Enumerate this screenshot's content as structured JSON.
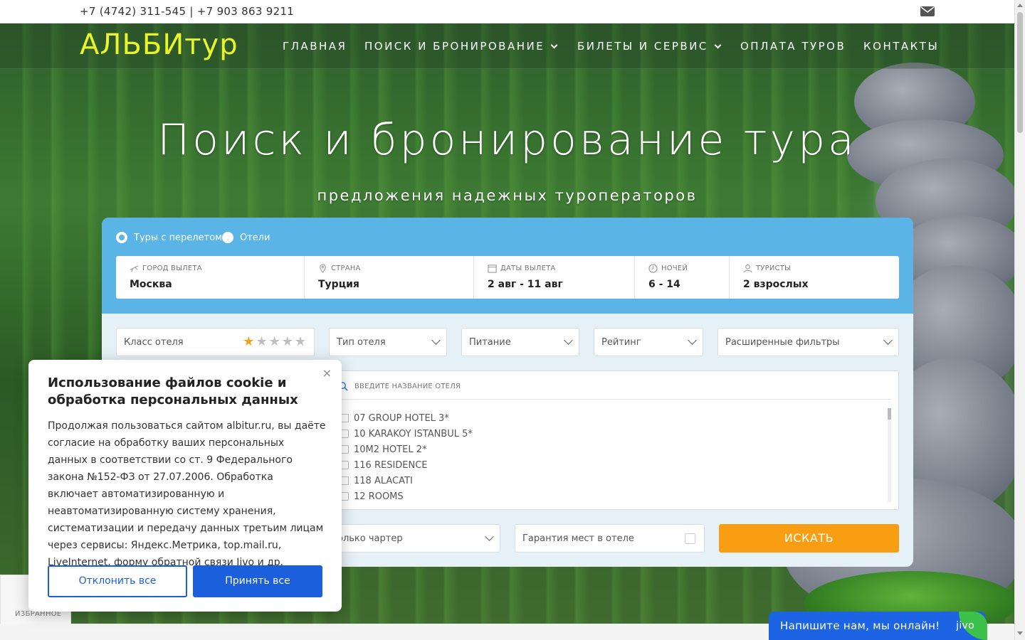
{
  "topbar": {
    "phones": "+7 (4742) 311-545 | +7 903 863 9211"
  },
  "nav": {
    "logo": "АЛЬБИтур",
    "items": [
      {
        "label": "ГЛАВНАЯ"
      },
      {
        "label": "ПОИСК И БРОНИРОВАНИЕ"
      },
      {
        "label": "БИЛЕТЫ И СЕРВИС"
      },
      {
        "label": "ОПЛАТА ТУРОВ"
      },
      {
        "label": "КОНТАКТЫ"
      }
    ]
  },
  "hero": {
    "title": "Поиск и бронирование тура",
    "subtitle": "предложения надежных туроператоров"
  },
  "search": {
    "modes": [
      {
        "label": "Туры с перелетом",
        "selected": true
      },
      {
        "label": "Отели",
        "selected": false
      }
    ],
    "fields": [
      {
        "label": "ГОРОД ВЫЛЕТА",
        "value": "Москва"
      },
      {
        "label": "СТРАНА",
        "value": "Турция"
      },
      {
        "label": "ДАТЫ ВЫЛЕТА",
        "value": "2 авг - 11 авг"
      },
      {
        "label": "НОЧЕЙ",
        "value": "6 - 14"
      },
      {
        "label": "ТУРИСТЫ",
        "value": "2 взрослых"
      }
    ],
    "filters": {
      "hotel_class": "Класс отеля",
      "hotel_class_stars": 1,
      "hotel_type": "Тип отеля",
      "meals": "Питание",
      "rating": "Рейтинг",
      "advanced": "Расширенные фильтры"
    },
    "hotel_search_placeholder": "ВВЕДИТЕ НАЗВАНИЕ ОТЕЛЯ",
    "hotels": [
      "07 GROUP HOTEL 3*",
      "10 KARAKOY ISTANBUL 5*",
      "10M2 HOTEL 2*",
      "116 RESIDENCE",
      "118 ALACATI",
      "12 ROOMS"
    ],
    "charter": "олько чартер",
    "guarantee": "Гарантия мест в отеле",
    "submit": "ИСКАТЬ"
  },
  "cookie": {
    "close": "×",
    "title": "Использование файлов cookie и обработка персональных данных",
    "text": "Продолжая пользоваться сайтом albitur.ru, вы даёте согласие на обработку ваших персональных данных в соответствии со ст. 9 Федерального закона №152-ФЗ от 27.07.2006. Обработка включает автоматизированную и неавтоматизированную систему хранения, систематизации и передачу данных третьим лицам через сервисы: Яндекс.Метрика, top.mail.ru, LiveInternet, форму обратной связи Jivo и др.",
    "decline": "Отклонить все",
    "accept": "Принять все"
  },
  "favorites": {
    "label": "ИЗБРАННОЕ"
  },
  "jivo": {
    "text": "Напишите нам, мы онлайн!",
    "brand": "jivo"
  },
  "colors": {
    "logo": "#e9f52a",
    "panel": "#5ab4e6",
    "submit": "#f99e12",
    "accent": "#1c5fdc",
    "jivo": "#1d64e4"
  }
}
